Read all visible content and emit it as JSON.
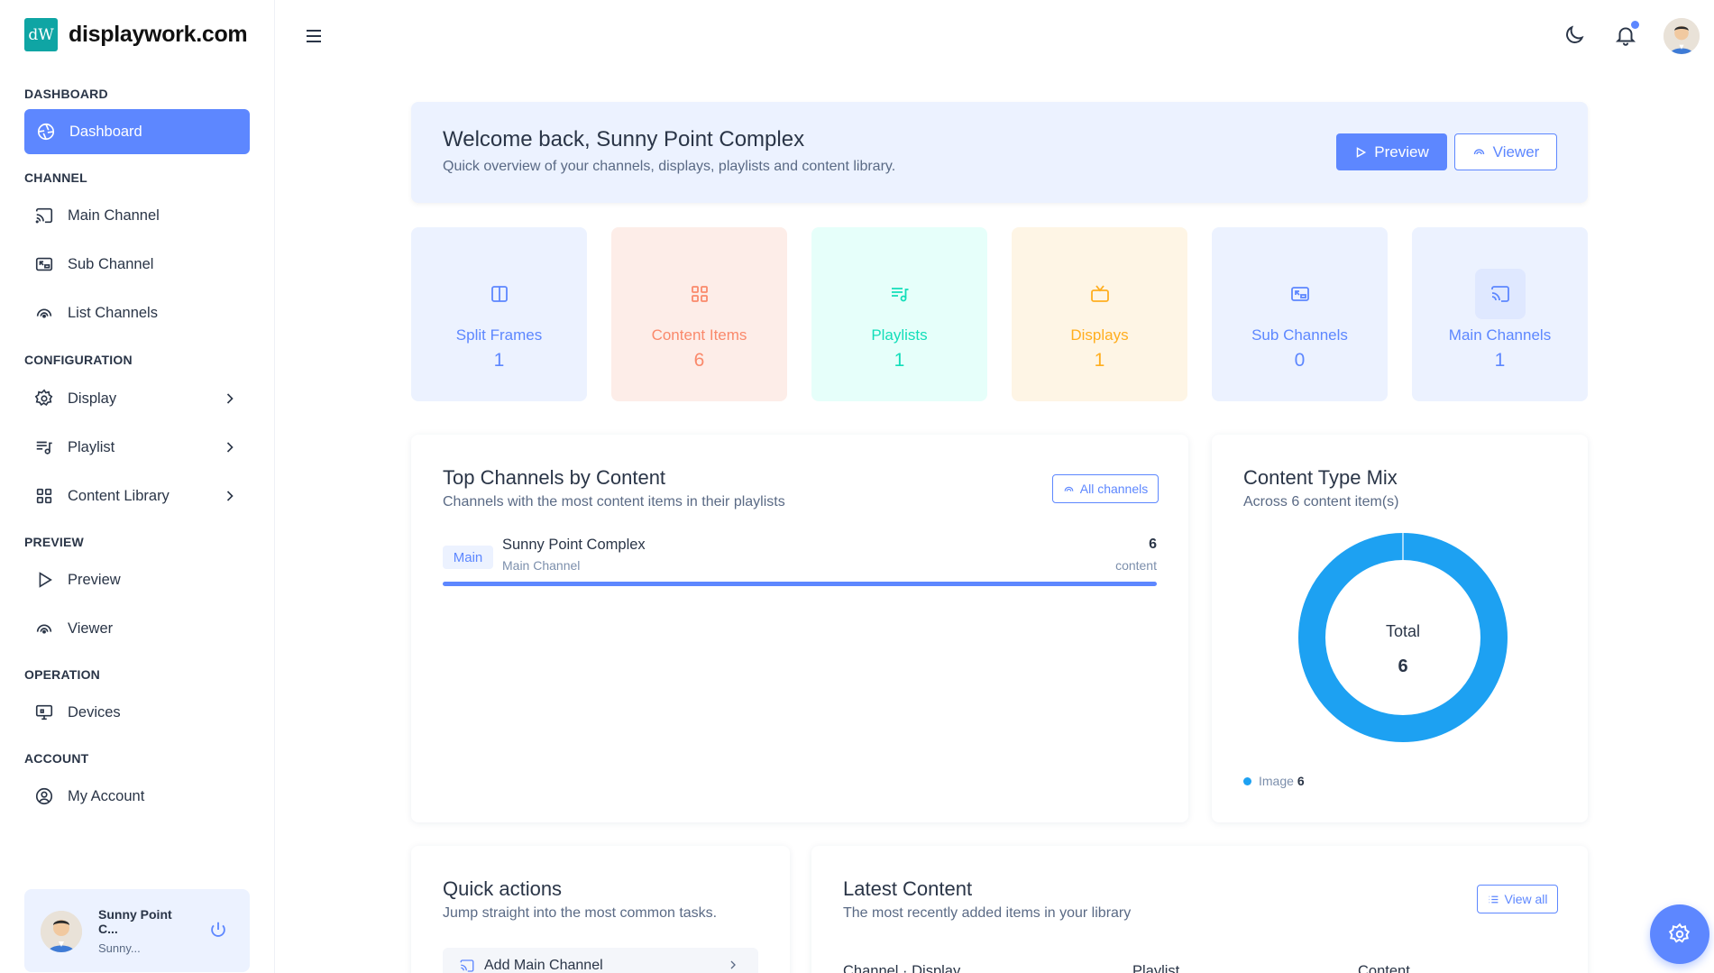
{
  "brand": {
    "logo_text": "dW",
    "name": "displaywork.com"
  },
  "sidebar": {
    "sections": {
      "dashboard": "DASHBOARD",
      "channel": "CHANNEL",
      "configuration": "CONFIGURATION",
      "preview": "PREVIEW",
      "operation": "OPERATION",
      "account": "ACCOUNT"
    },
    "items": {
      "dashboard": "Dashboard",
      "main_channel": "Main Channel",
      "sub_channel": "Sub Channel",
      "list_channels": "List Channels",
      "display": "Display",
      "playlist": "Playlist",
      "content_library": "Content Library",
      "preview": "Preview",
      "viewer": "Viewer",
      "devices": "Devices",
      "my_account": "My Account"
    },
    "user": {
      "name": "Sunny Point C...",
      "sub": "Sunny..."
    }
  },
  "welcome": {
    "title": "Welcome back, Sunny Point Complex",
    "subtitle": "Quick overview of your channels, displays, playlists and content library.",
    "preview_label": "Preview",
    "viewer_label": "Viewer"
  },
  "stats": [
    {
      "label": "Split Frames",
      "value": "1",
      "color": "#5d87ff",
      "bg": "#ecf2ff"
    },
    {
      "label": "Content Items",
      "value": "6",
      "color": "#fa896b",
      "bg": "#fdede8"
    },
    {
      "label": "Playlists",
      "value": "1",
      "color": "#13deb9",
      "bg": "#e6fffa"
    },
    {
      "label": "Displays",
      "value": "1",
      "color": "#ffae1f",
      "bg": "#fef5e5"
    },
    {
      "label": "Sub Channels",
      "value": "0",
      "color": "#5d87ff",
      "bg": "#ecf2ff"
    },
    {
      "label": "Main Channels",
      "value": "1",
      "color": "#5d87ff",
      "bg": "#ecf2ff"
    }
  ],
  "top_channels": {
    "title": "Top Channels by Content",
    "subtitle": "Channels with the most content items in their playlists",
    "button_label": "All channels",
    "rows": [
      {
        "badge": "Main",
        "name": "Sunny Point Complex",
        "type": "Main Channel",
        "count": "6",
        "unit": "content",
        "share": 1.0
      }
    ]
  },
  "content_mix": {
    "title": "Content Type Mix",
    "subtitle": "Across 6 content item(s)",
    "total_label": "Total",
    "total_value": "6",
    "legend": [
      {
        "name": "Image",
        "value": "6",
        "color": "#1da1f2"
      }
    ]
  },
  "chart_data": {
    "type": "pie",
    "categories": [
      "Image"
    ],
    "values": [
      6
    ],
    "title": "Content Type Mix",
    "subtitle": "Across 6 content item(s)"
  },
  "quick_actions": {
    "title": "Quick actions",
    "subtitle": "Jump straight into the most common tasks.",
    "items": [
      {
        "label": "Add Main Channel"
      }
    ]
  },
  "latest_content": {
    "title": "Latest Content",
    "subtitle": "The most recently added items in your library",
    "button_label": "View all",
    "columns": [
      "Channel · Display",
      "Playlist",
      "Content"
    ]
  },
  "colors": {
    "accent": "#5d87ff",
    "donut": "#1da1f2"
  }
}
